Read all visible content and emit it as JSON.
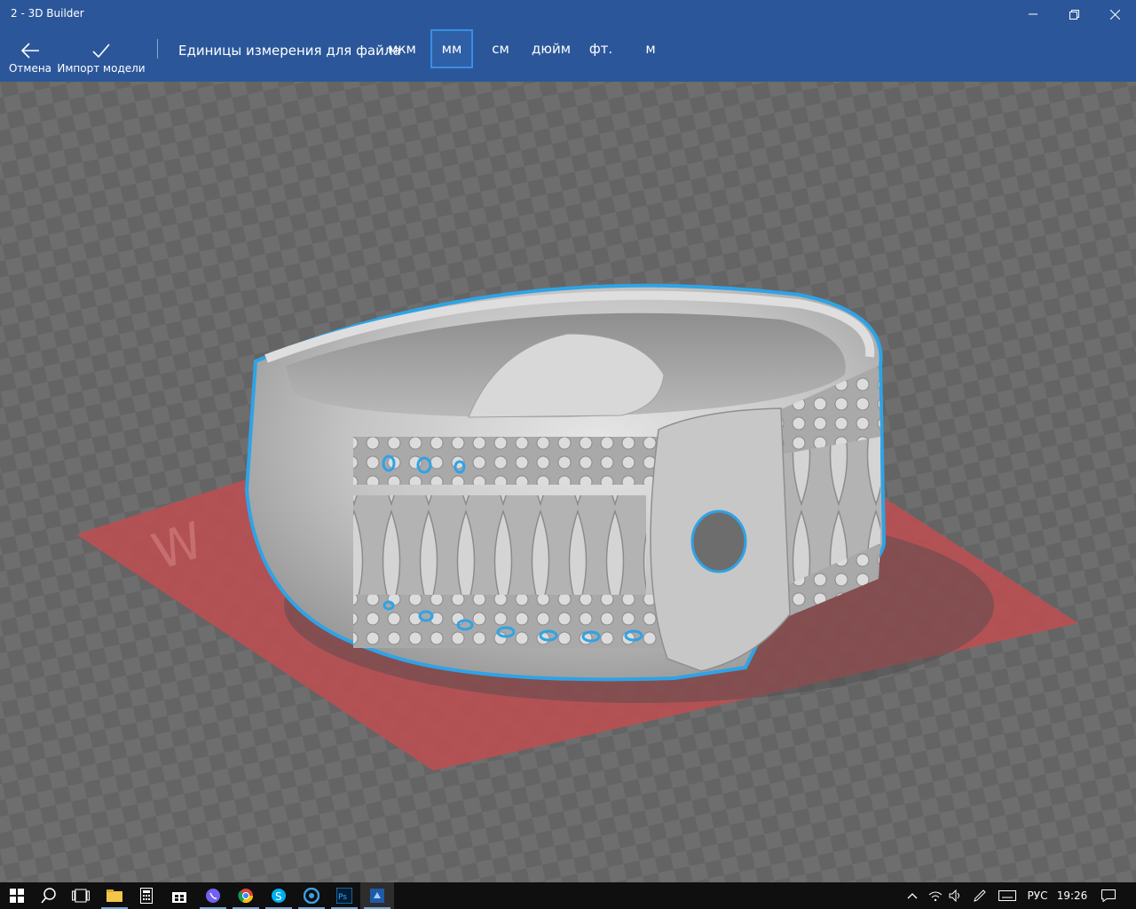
{
  "window": {
    "title": "2 - 3D Builder"
  },
  "toolbar": {
    "cancel_label": "Отмена",
    "import_label": "Импорт модели",
    "units_label": "Единицы измерения для файла",
    "units": [
      "мкм",
      "мм",
      "см",
      "дюйм",
      "фт.",
      "м"
    ],
    "selected_unit": "мм"
  },
  "viewport": {
    "grid_color": "#6b6b6b",
    "plate_color": "#b84f52",
    "model_color": "#bdbdbd",
    "selection_outline_color": "#2fa3e6"
  },
  "taskbar": {
    "lang": "РУС",
    "time": "19:26",
    "icons": [
      "windows-start-icon",
      "search-icon",
      "task-view-icon",
      "file-explorer-icon",
      "calculator-icon",
      "store-icon",
      "viber-icon",
      "chrome-icon",
      "skype-icon",
      "browser-icon",
      "photoshop-icon",
      "3d-builder-icon"
    ]
  }
}
